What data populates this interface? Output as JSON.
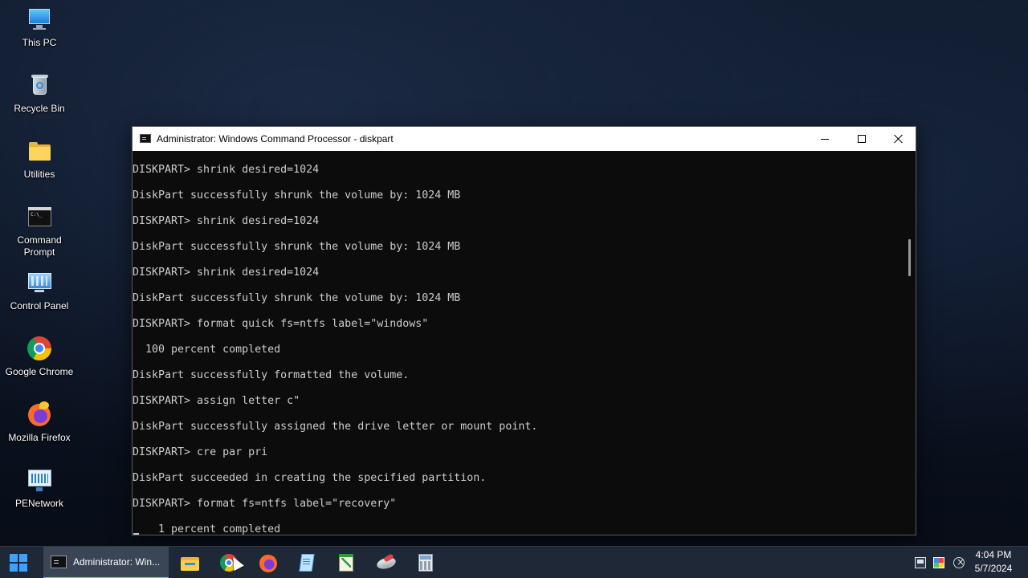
{
  "desktop": {
    "icons": [
      {
        "label": "This PC",
        "icon": "this-pc-icon"
      },
      {
        "label": "Recycle Bin",
        "icon": "recycle-bin-icon"
      },
      {
        "label": "Utilities",
        "icon": "folder-icon"
      },
      {
        "label": "Command Prompt",
        "icon": "command-prompt-icon"
      },
      {
        "label": "Control Panel",
        "icon": "control-panel-icon"
      },
      {
        "label": "Google Chrome",
        "icon": "chrome-icon"
      },
      {
        "label": "Mozilla Firefox",
        "icon": "firefox-icon"
      },
      {
        "label": "PENetwork",
        "icon": "network-icon"
      }
    ]
  },
  "window": {
    "title": "Administrator: Windows Command Processor - diskpart",
    "controls": {
      "minimize": "minimize",
      "maximize": "maximize",
      "close": "close"
    },
    "console_lines": [
      "DISKPART> shrink desired=1024",
      "",
      "DiskPart successfully shrunk the volume by: 1024 MB",
      "",
      "DISKPART> shrink desired=1024",
      "",
      "DiskPart successfully shrunk the volume by: 1024 MB",
      "",
      "DISKPART> shrink desired=1024",
      "",
      "DiskPart successfully shrunk the volume by: 1024 MB",
      "",
      "DISKPART> format quick fs=ntfs label=\"windows\"",
      "",
      "  100 percent completed",
      "",
      "DiskPart successfully formatted the volume.",
      "",
      "DISKPART> assign letter c\"",
      "",
      "DiskPart successfully assigned the drive letter or mount point.",
      "",
      "DISKPART> cre par pri",
      "",
      "DiskPart succeeded in creating the specified partition.",
      "",
      "DISKPART> format fs=ntfs label=\"recovery\"",
      "",
      "    1 percent completed"
    ]
  },
  "taskbar": {
    "start_icon": "windows-start-icon",
    "active_task_label": "Administrator: Win...",
    "pinned": [
      "file-explorer-icon",
      "chrome-icon",
      "firefox-icon",
      "notepad-icon",
      "spreadsheet-editor-icon",
      "disk-tool-icon",
      "calculator-icon"
    ],
    "tray": [
      "network-icon",
      "color-icon",
      "speaker-muted-icon"
    ],
    "clock": {
      "time": "4:04 PM",
      "date": "5/7/2024"
    }
  },
  "colors": {
    "console_bg": "#0c0c0c",
    "console_fg": "#cccccc",
    "taskbar_bg": "#1f2836",
    "accent": "#3aa3ff"
  }
}
